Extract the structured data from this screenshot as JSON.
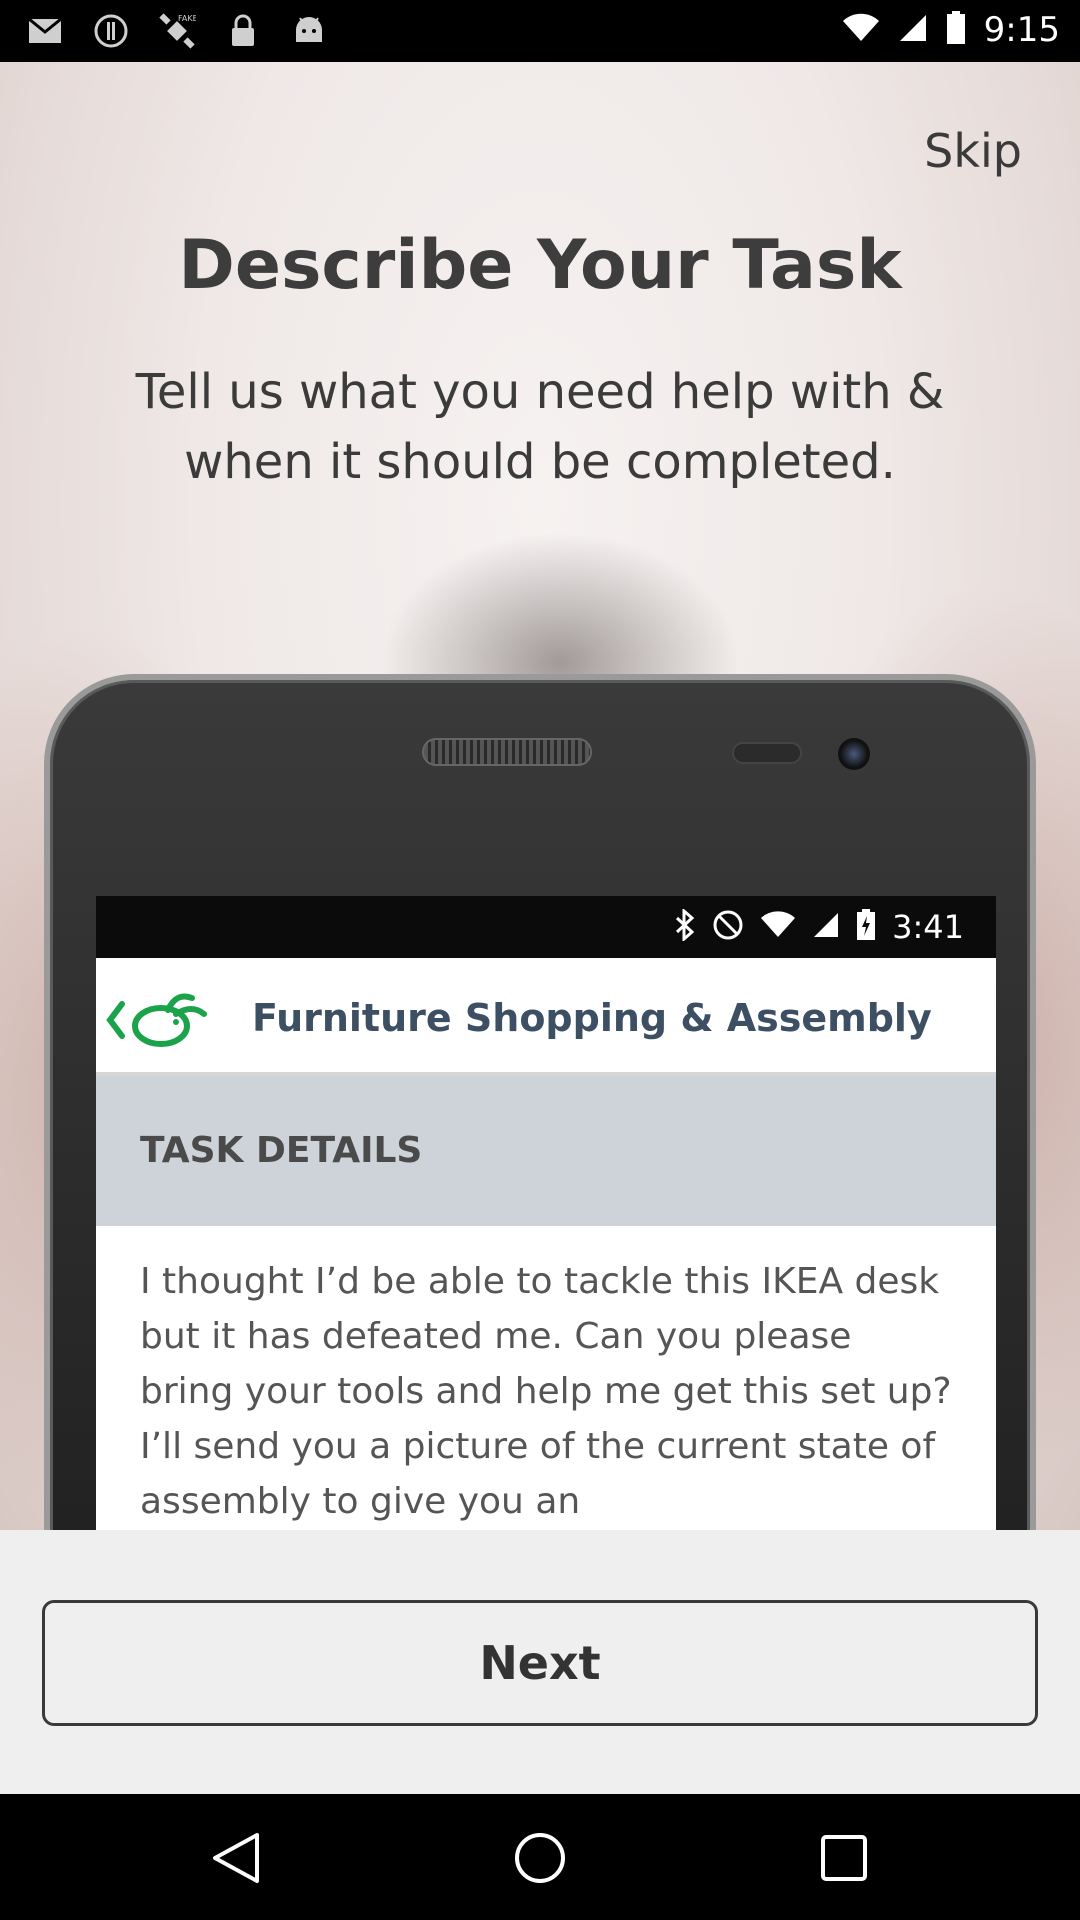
{
  "status_bar": {
    "time": "9:15",
    "icons": [
      "mail-icon",
      "circle-pause-icon",
      "fake-gps-icon",
      "lock-icon",
      "android-icon"
    ]
  },
  "header": {
    "skip_label": "Skip",
    "title": "Describe Your Task",
    "subtitle": "Tell us what you need help with & when it should be completed."
  },
  "phone_preview": {
    "status_time": "3:41",
    "screen_title": "Furniture Shopping & Assembly",
    "section_label": "TASK DETAILS",
    "task_text": "I thought I’d be able to tackle this IKEA desk but it has defeated me. Can you please bring your tools and help me get this set up? I’ll send you a picture of the current state of assembly to give you an"
  },
  "footer": {
    "next_label": "Next"
  },
  "colors": {
    "accent_blue": "#1797c6",
    "logo_green": "#1aa34a"
  }
}
